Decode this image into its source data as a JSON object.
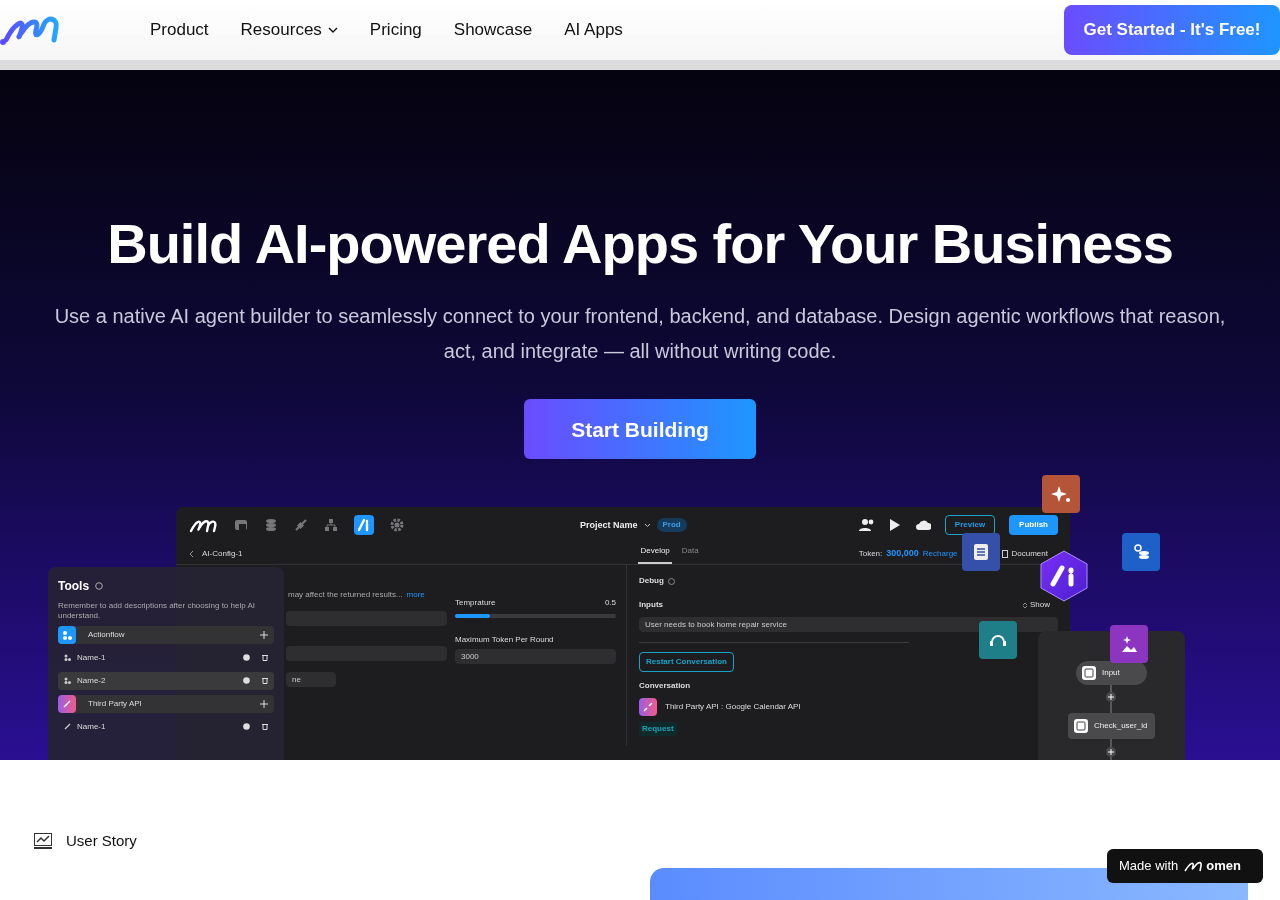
{
  "nav": {
    "links": [
      {
        "label": "Product",
        "dropdown": false
      },
      {
        "label": "Resources",
        "dropdown": true
      },
      {
        "label": "Pricing",
        "dropdown": false
      },
      {
        "label": "Showcase",
        "dropdown": false
      },
      {
        "label": "AI Apps",
        "dropdown": false
      }
    ],
    "cta": "Get Started - It's Free!"
  },
  "hero": {
    "title": "Build AI-powered Apps for Your Business",
    "subtitle": "Use a native AI agent builder to seamlessly connect to your frontend, backend, and database. Design agentic workflows that reason, act, and integrate — all without writing code.",
    "button": "Start Building"
  },
  "app": {
    "project_name": "Project Name",
    "env_badge": "Prod",
    "preview_button": "Preview",
    "publish_button": "Publish",
    "breadcrumb": "AI-Config-1",
    "tabs": [
      {
        "label": "Develop",
        "selected": true
      },
      {
        "label": "Data",
        "selected": false
      }
    ],
    "token_label": "Token:",
    "token_value": "300,000",
    "recharge": "Recharge",
    "document": "Document",
    "hint": "may affect the returned results...",
    "more": "more",
    "temperature": {
      "label": "Temprature",
      "reading": "0.5",
      "level": 0.22
    },
    "max_token": {
      "label": "Maximum Token Per Round",
      "value": "3000"
    },
    "partial_field": "ne",
    "debug": {
      "title": "Debug",
      "show": "Show",
      "inputs_label": "Inputs",
      "input_value": "User needs to book home repair service",
      "restart": "Restart Conversation",
      "conversation_label": "Conversation",
      "conversation_item": "Third Party API : Google Calendar API",
      "request": "Request"
    }
  },
  "tools_panel": {
    "title": "Tools",
    "hint": "Remember to add descriptions after choosing to help AI understand.",
    "groups": [
      {
        "kind": "actionflow",
        "label": "Actionflow",
        "items": [
          {
            "name": "Name-1",
            "selected": false
          },
          {
            "name": "Name-2",
            "selected": true
          }
        ]
      },
      {
        "kind": "api",
        "label": "Third Party API",
        "items": [
          {
            "name": "Name-1",
            "selected": false
          }
        ]
      }
    ]
  },
  "flow": {
    "nodes": [
      {
        "kind": "input",
        "label": "Input"
      },
      {
        "kind": "check",
        "label": "Check_user_id"
      }
    ]
  },
  "section": {
    "label": "User Story"
  },
  "badge": {
    "text": "Made with",
    "brand": "omen"
  }
}
